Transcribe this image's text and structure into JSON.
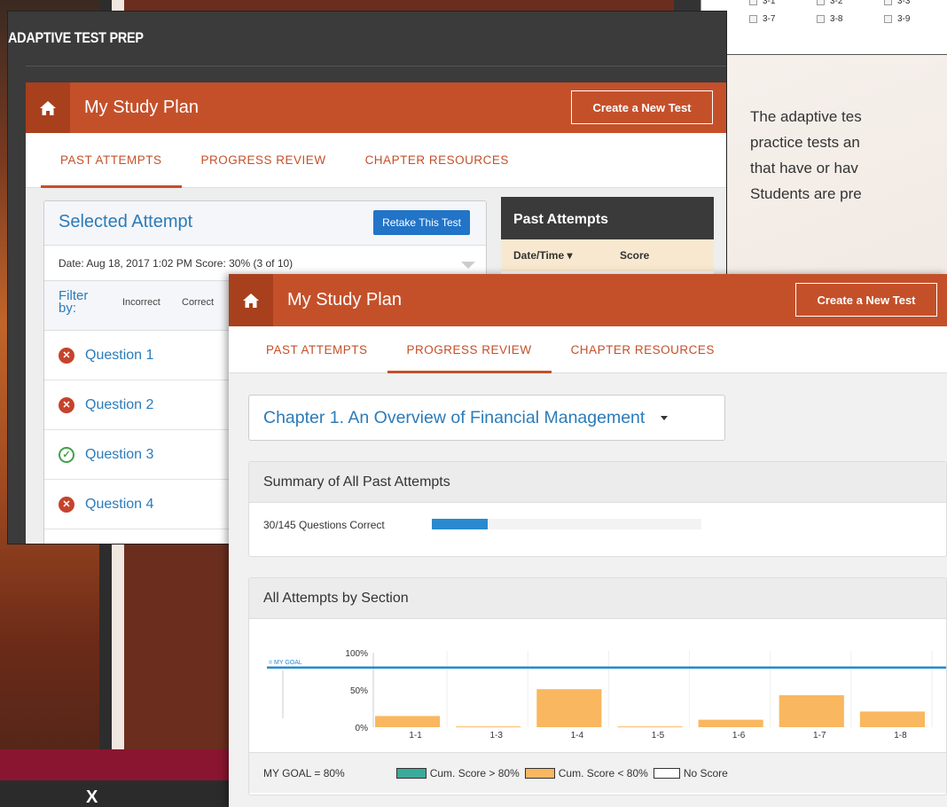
{
  "background": {
    "side_text": [
      "The adaptive tes",
      "practice tests an",
      "that have or hav",
      "Students are pre"
    ],
    "checkboxes": [
      {
        "label": "3-7"
      },
      {
        "label": "3-8"
      },
      {
        "label": "3-9"
      }
    ],
    "partial_checkboxes": [
      {
        "label": "3-1"
      },
      {
        "label": "3-2"
      },
      {
        "label": "3-3"
      }
    ],
    "bottom_mark": "X"
  },
  "back_window": {
    "title": "ADAPTIVE TEST PREP",
    "header": {
      "title": "My Study Plan",
      "create_button": "Create a New Test"
    },
    "tabs": [
      {
        "label": "PAST ATTEMPTS",
        "active": true
      },
      {
        "label": "PROGRESS REVIEW",
        "active": false
      },
      {
        "label": "CHAPTER RESOURCES",
        "active": false
      }
    ],
    "selected_attempt": {
      "title": "Selected Attempt",
      "retake_button": "Retake This Test",
      "date_line": "Date: Aug 18, 2017 1:02 PM Score: 30% (3 of 10)",
      "filter_label": "Filter by:",
      "filter_options": [
        "Incorrect",
        "Correct"
      ],
      "questions": [
        {
          "label": "Question 1",
          "status": "incorrect"
        },
        {
          "label": "Question 2",
          "status": "incorrect"
        },
        {
          "label": "Question 3",
          "status": "correct"
        },
        {
          "label": "Question 4",
          "status": "incorrect"
        }
      ]
    },
    "past_attempts": {
      "title": "Past Attempts",
      "col_date": "Date/Time ▾",
      "col_score": "Score"
    }
  },
  "front_window": {
    "header": {
      "title": "My Study Plan",
      "create_button": "Create a New Test"
    },
    "tabs": [
      {
        "label": "PAST ATTEMPTS",
        "active": false
      },
      {
        "label": "PROGRESS REVIEW",
        "active": true
      },
      {
        "label": "CHAPTER RESOURCES",
        "active": false
      }
    ],
    "chapter_select": "Chapter 1. An Overview of Financial Management",
    "summary": {
      "title": "Summary of All Past Attempts",
      "text": "30/145 Questions Correct",
      "correct": 30,
      "total": 145
    },
    "by_section": {
      "title": "All Attempts by Section",
      "goal_label": "MY GOAL",
      "legend_goal": "MY GOAL = 80%",
      "legend_items": [
        {
          "label": "Cum. Score > 80%",
          "color": "#3aaa9a"
        },
        {
          "label": "Cum. Score < 80%",
          "color": "#f9b75f"
        },
        {
          "label": "No Score",
          "color": "#ffffff"
        }
      ]
    }
  },
  "chart_data": {
    "type": "bar",
    "categories": [
      "1-1",
      "1-3",
      "1-4",
      "1-5",
      "1-6",
      "1-7",
      "1-8"
    ],
    "values": [
      15,
      1,
      51,
      1,
      10,
      43,
      21
    ],
    "goal": 80,
    "ylim": [
      0,
      100
    ],
    "yticks": [
      "0%",
      "50%",
      "100%"
    ],
    "bar_color": "#f9b75f",
    "goal_color": "#2a89cf"
  }
}
